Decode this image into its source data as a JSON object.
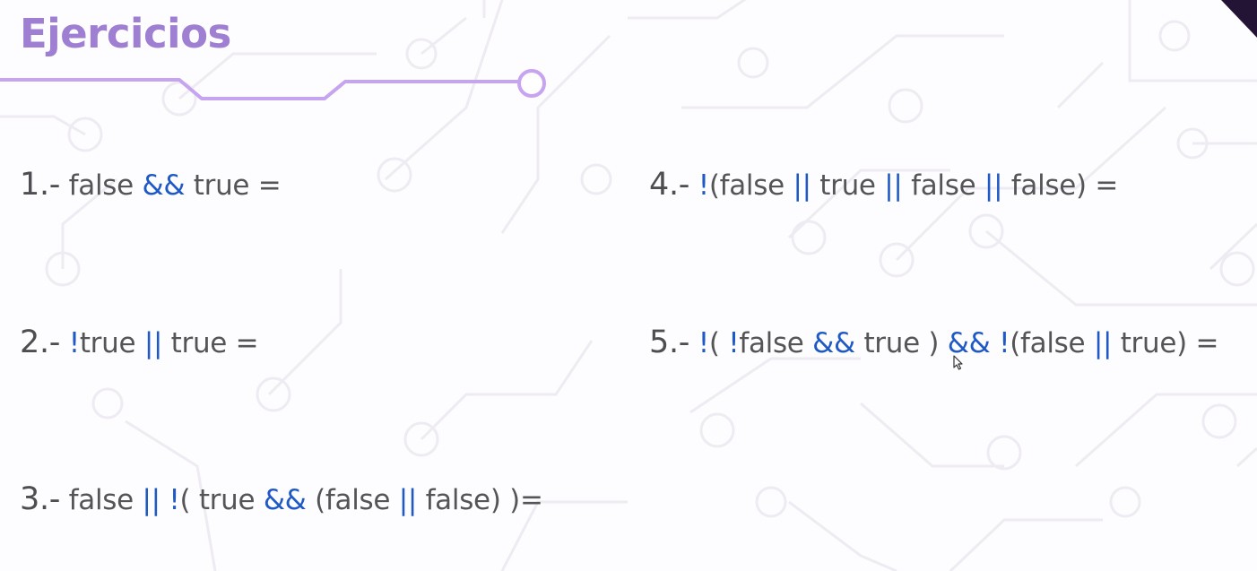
{
  "title": "Ejercicios",
  "colors": {
    "title": "#9f7fd1",
    "accent_line": "#c6a4f0",
    "operator": "#1f59c5",
    "text": "#555557",
    "corner": "#231335"
  },
  "exercises": [
    {
      "number": "1.-",
      "tokens": [
        {
          "t": " false ",
          "op": false
        },
        {
          "t": "&&",
          "op": true
        },
        {
          "t": " true =",
          "op": false
        }
      ]
    },
    {
      "number": "2.-",
      "tokens": [
        {
          "t": " ",
          "op": false
        },
        {
          "t": "!",
          "op": true
        },
        {
          "t": "true ",
          "op": false
        },
        {
          "t": "||",
          "op": true
        },
        {
          "t": " true =",
          "op": false
        }
      ]
    },
    {
      "number": "3.-",
      "tokens": [
        {
          "t": " false ",
          "op": false
        },
        {
          "t": "||",
          "op": true
        },
        {
          "t": " ",
          "op": false
        },
        {
          "t": "!",
          "op": true
        },
        {
          "t": "( true ",
          "op": false
        },
        {
          "t": "&&",
          "op": true
        },
        {
          "t": " (false ",
          "op": false
        },
        {
          "t": "||",
          "op": true
        },
        {
          "t": " false) )=",
          "op": false
        }
      ]
    },
    {
      "number": "4.-",
      "tokens": [
        {
          "t": " ",
          "op": false
        },
        {
          "t": "!",
          "op": true
        },
        {
          "t": "(false ",
          "op": false
        },
        {
          "t": "||",
          "op": true
        },
        {
          "t": " true ",
          "op": false
        },
        {
          "t": "||",
          "op": true
        },
        {
          "t": " false ",
          "op": false
        },
        {
          "t": "||",
          "op": true
        },
        {
          "t": " false) =",
          "op": false
        }
      ]
    },
    {
      "number": "5.-",
      "tokens": [
        {
          "t": " ",
          "op": false
        },
        {
          "t": "!",
          "op": true
        },
        {
          "t": "( ",
          "op": false
        },
        {
          "t": "!",
          "op": true
        },
        {
          "t": "false ",
          "op": false
        },
        {
          "t": "&&",
          "op": true
        },
        {
          "t": " true ) ",
          "op": false
        },
        {
          "t": "&&",
          "op": true
        },
        {
          "t": " ",
          "op": false
        },
        {
          "t": "!",
          "op": true
        },
        {
          "t": "(false ",
          "op": false
        },
        {
          "t": "||",
          "op": true
        },
        {
          "t": " true) =",
          "op": false
        }
      ]
    }
  ],
  "icons": {
    "cursor": "mouse-pointer-icon"
  }
}
